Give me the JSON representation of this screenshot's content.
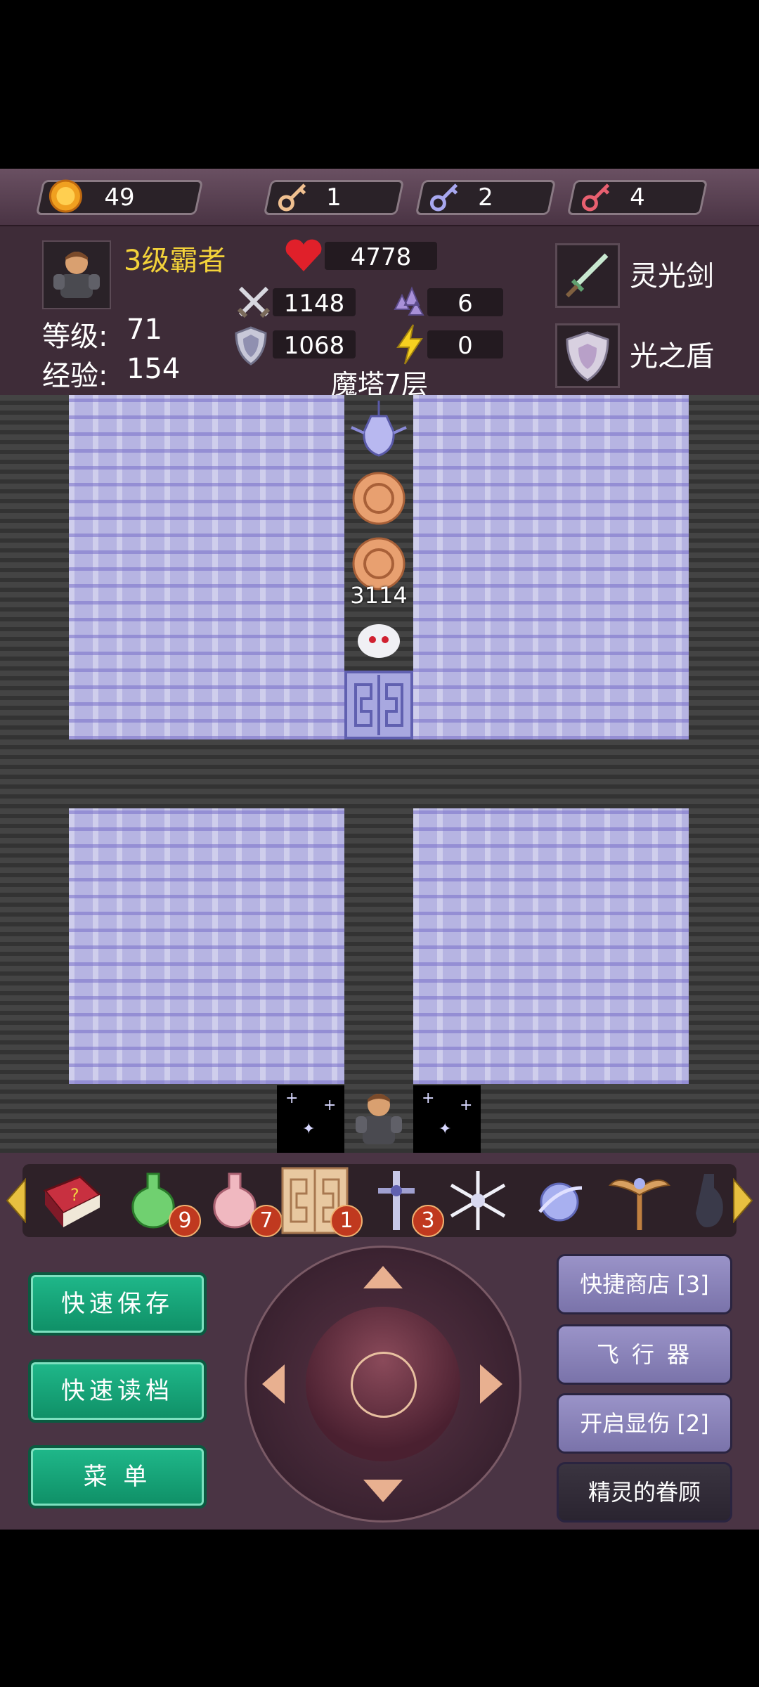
{
  "resources": {
    "gold": "49",
    "yellow_key": "1",
    "blue_key": "2",
    "red_key": "4"
  },
  "hero": {
    "title": "3级霸者",
    "level_label": "等级:",
    "level": "71",
    "exp_label": "经验:",
    "exp": "154",
    "hp": "4778",
    "attack": "1148",
    "defense": "1068",
    "magic_def": "6",
    "energy": "0"
  },
  "equipment": {
    "weapon": "灵光剑",
    "shield": "光之盾"
  },
  "floor": "魔塔7层",
  "map": {
    "monster_damage": "3114"
  },
  "items": [
    {
      "name": "monster-manual",
      "count": ""
    },
    {
      "name": "green-potion",
      "count": "9"
    },
    {
      "name": "pink-potion",
      "count": "7"
    },
    {
      "name": "door-scroll",
      "count": "1"
    },
    {
      "name": "cross-sword",
      "count": "3"
    },
    {
      "name": "snowflake",
      "count": ""
    },
    {
      "name": "crystal-orb",
      "count": ""
    },
    {
      "name": "winged-staff",
      "count": ""
    },
    {
      "name": "dark-vase",
      "count": ""
    }
  ],
  "buttons": {
    "quick_save": "快速保存",
    "quick_load": "快速读档",
    "menu": "菜 单",
    "shop": "快捷商店 [3]",
    "flyer": "飞 行 器",
    "show_damage": "开启显伤 [2]",
    "fairy": "精灵的眷顾"
  },
  "colors": {
    "title_yellow": "#f3d23a",
    "green_button": "#1aa57a",
    "purple_button": "#8a83bc"
  }
}
